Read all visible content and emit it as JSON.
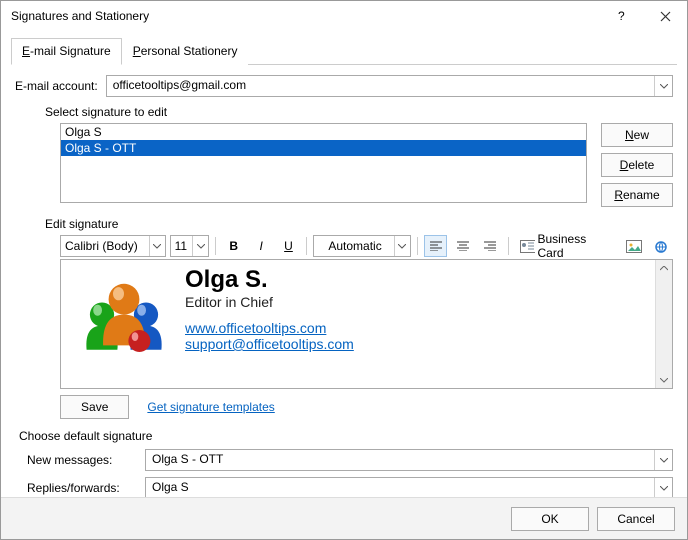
{
  "window": {
    "title": "Signatures and Stationery"
  },
  "tabs": {
    "email": {
      "prefix": "E",
      "rest": "-mail Signature"
    },
    "stationery": {
      "prefix": "P",
      "rest": "ersonal Stationery"
    }
  },
  "account": {
    "label_prefix": "E",
    "label_rest": "-mail account:",
    "value": "officetooltips@gmail.com"
  },
  "select_sig_label": "Select signature to edit",
  "sig_list": {
    "item0": "Olga S",
    "item1": "Olga S - OTT"
  },
  "buttons": {
    "new_prefix": "N",
    "new_rest": "ew",
    "delete_prefix": "D",
    "delete_rest": "elete",
    "rename_prefix": "R",
    "rename_rest": "ename",
    "save_prefix": "S",
    "save_rest": "ave",
    "ok": "OK",
    "cancel": "Cancel"
  },
  "edit_label": "Edit signature",
  "toolbar": {
    "font": "Calibri (Body)",
    "size": "11",
    "color": "Automatic",
    "bcard_prefix": "B",
    "bcard_rest": "usiness Card"
  },
  "signature": {
    "name": "Olga S.",
    "role": "Editor in Chief",
    "url": "www.officetooltips.com",
    "email": "support@officetooltips.com"
  },
  "templates_link": "Get signature templates",
  "defaults": {
    "label": "Choose default signature",
    "newmsg_label": "New messages:",
    "newmsg_value": "Olga S - OTT",
    "replies_label_prefix": "Replies/",
    "replies_label_u": "f",
    "replies_label_rest": "orwards:",
    "replies_value": "Olga S"
  }
}
